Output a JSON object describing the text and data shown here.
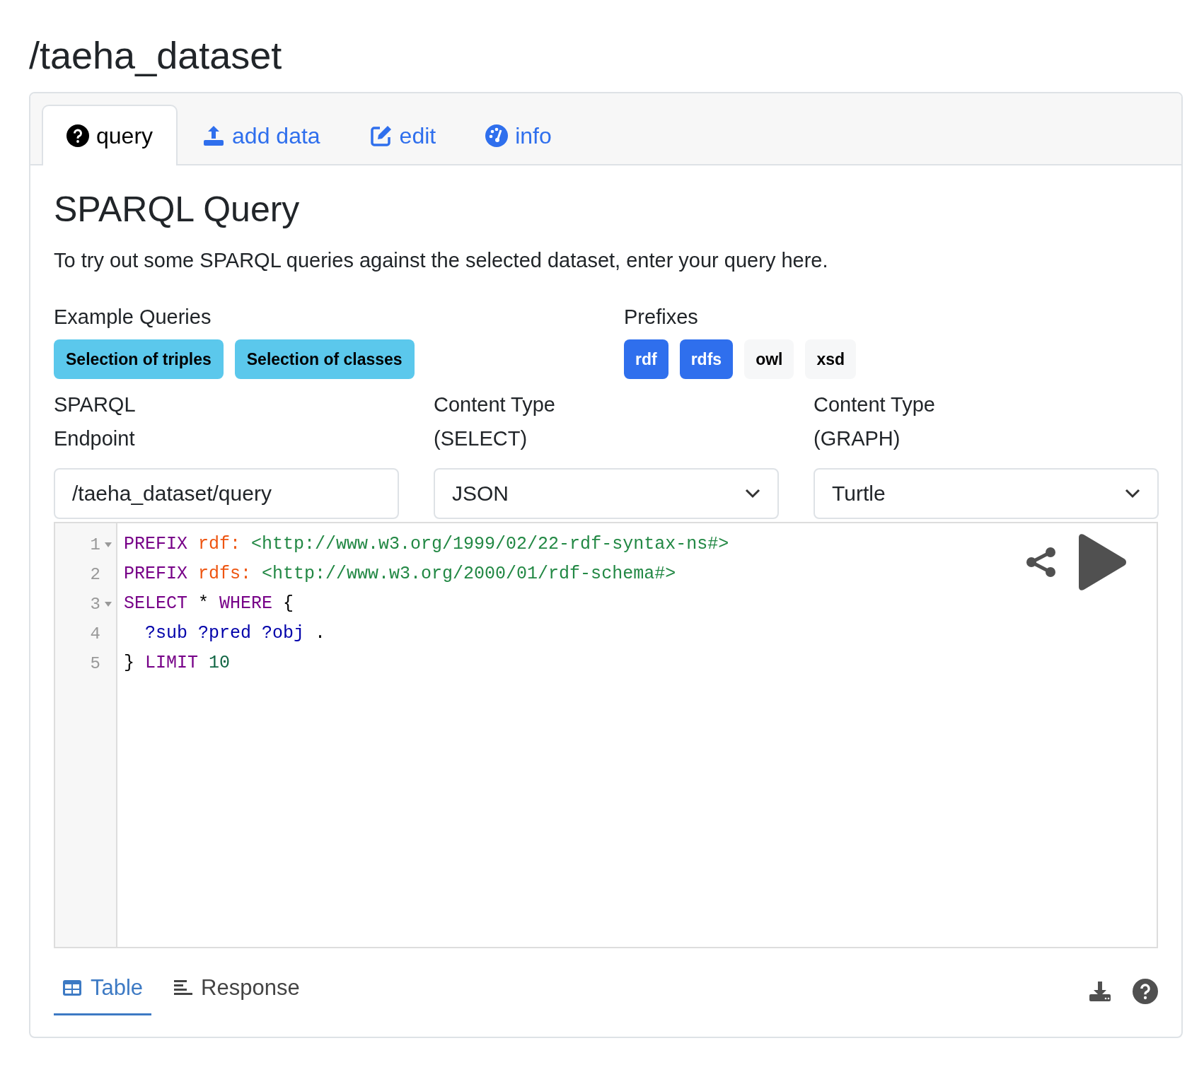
{
  "page_title": "/taeha_dataset",
  "tabs": [
    {
      "label": "query",
      "selected": true
    },
    {
      "label": "add data",
      "selected": false
    },
    {
      "label": "edit",
      "selected": false
    },
    {
      "label": "info",
      "selected": false
    }
  ],
  "heading": "SPARQL Query",
  "intro": "To try out some SPARQL queries against the selected dataset, enter your query here.",
  "example_queries": {
    "label": "Example Queries",
    "buttons": [
      "Selection of triples",
      "Selection of classes"
    ]
  },
  "prefixes": {
    "label": "Prefixes",
    "items": [
      {
        "label": "rdf",
        "selected": true
      },
      {
        "label": "rdfs",
        "selected": true
      },
      {
        "label": "owl",
        "selected": false
      },
      {
        "label": "xsd",
        "selected": false
      }
    ]
  },
  "fields": [
    {
      "kind": "text",
      "label_lines": [
        "SPARQL",
        "Endpoint"
      ],
      "value": "/taeha_dataset/query"
    },
    {
      "kind": "select",
      "label_lines": [
        "Content Type",
        "(SELECT)"
      ],
      "value": "JSON"
    },
    {
      "kind": "select",
      "label_lines": [
        "Content Type",
        "(GRAPH)"
      ],
      "value": "Turtle"
    }
  ],
  "editor": {
    "lines": [
      {
        "number": "1",
        "foldable": true,
        "tokens": [
          {
            "kind": "keyword",
            "text": "PREFIX "
          },
          {
            "kind": "prefix",
            "text": "rdf: "
          },
          {
            "kind": "iri",
            "text": "<http://www.w3.org/1999/02/22-rdf-syntax-ns#>"
          }
        ]
      },
      {
        "number": "2",
        "foldable": false,
        "tokens": [
          {
            "kind": "keyword",
            "text": "PREFIX "
          },
          {
            "kind": "prefix",
            "text": "rdfs: "
          },
          {
            "kind": "iri",
            "text": "<http://www.w3.org/2000/01/rdf-schema#>"
          }
        ]
      },
      {
        "number": "3",
        "foldable": true,
        "tokens": [
          {
            "kind": "keyword",
            "text": "SELECT"
          },
          {
            "kind": "plain",
            "text": " * "
          },
          {
            "kind": "keyword",
            "text": "WHERE"
          },
          {
            "kind": "plain",
            "text": " {"
          }
        ]
      },
      {
        "number": "4",
        "foldable": false,
        "tokens": [
          {
            "kind": "variable",
            "text": "  ?sub ?pred ?obj"
          },
          {
            "kind": "plain",
            "text": " ."
          }
        ]
      },
      {
        "number": "5",
        "foldable": false,
        "tokens": [
          {
            "kind": "plain",
            "text": "} "
          },
          {
            "kind": "keyword",
            "text": "LIMIT "
          },
          {
            "kind": "number",
            "text": "10"
          }
        ]
      }
    ]
  },
  "result_tabs": [
    {
      "label": "Table",
      "selected": true
    },
    {
      "label": "Response",
      "selected": false
    }
  ]
}
